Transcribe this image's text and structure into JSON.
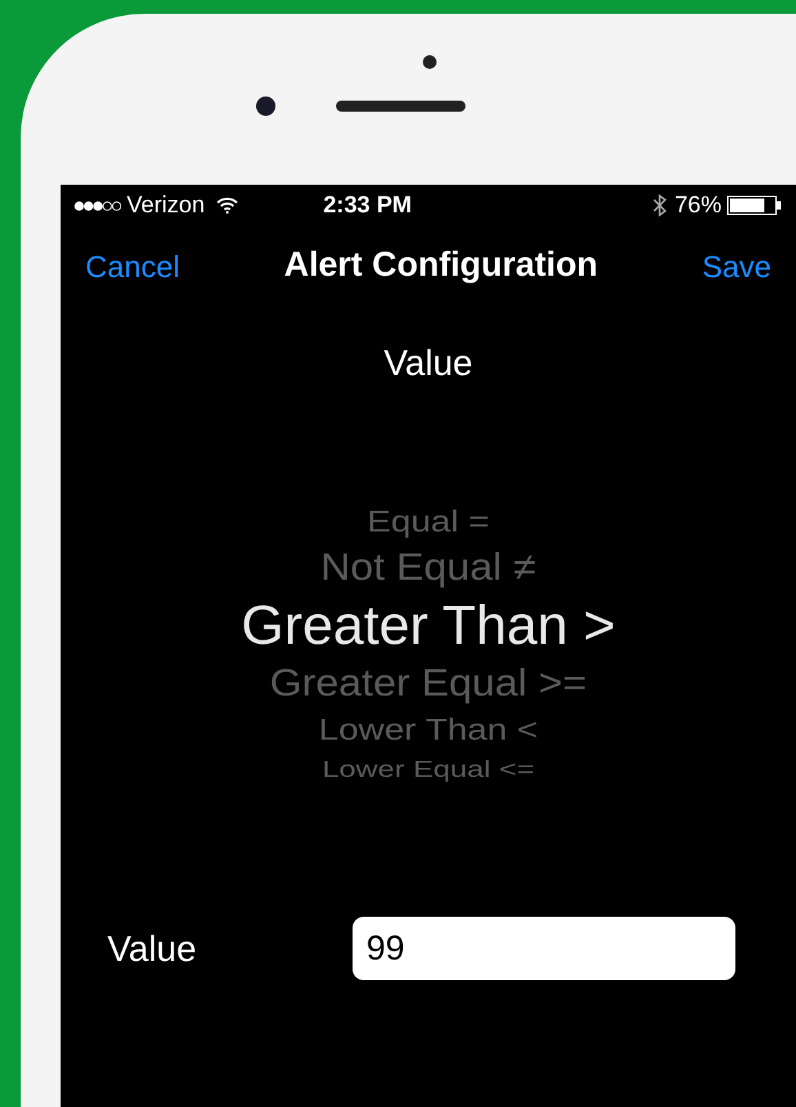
{
  "status_bar": {
    "carrier": "Verizon",
    "time": "2:33 PM",
    "battery": "76%"
  },
  "nav": {
    "cancel": "Cancel",
    "title": "Alert Configuration",
    "save": "Save"
  },
  "section_title": "Value",
  "picker": [
    {
      "label": "Equal =",
      "selected": false
    },
    {
      "label": "Not Equal ≠",
      "selected": false
    },
    {
      "label": "Greater Than >",
      "selected": true
    },
    {
      "label": "Greater Equal >=",
      "selected": false
    },
    {
      "label": "Lower Than <",
      "selected": false
    },
    {
      "label": "Lower Equal <=",
      "selected": false
    }
  ],
  "value_row": {
    "label": "Value",
    "value": "99"
  }
}
